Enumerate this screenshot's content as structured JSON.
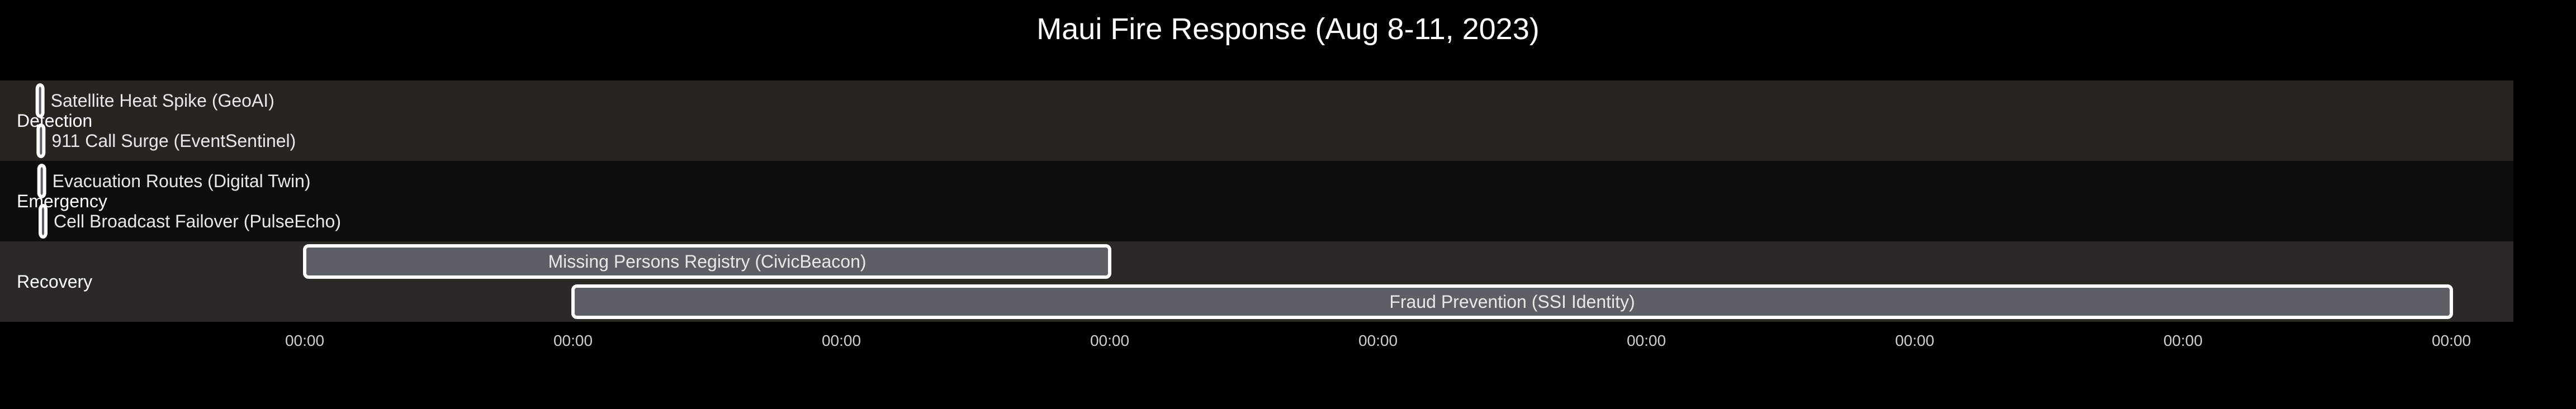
{
  "chart_data": {
    "type": "gantt",
    "title": "Maui Fire Response (Aug 8-11, 2023)",
    "sections": [
      {
        "name": "Detection",
        "tasks": [
          {
            "label": "Satellite Heat Spike (GeoAI)",
            "start": "2023-08-08 00:05",
            "end": "2023-08-08 00:06"
          },
          {
            "label": "911 Call Surge (EventSentinel)",
            "start": "2023-08-08 00:10",
            "end": "2023-08-08 00:11"
          }
        ]
      },
      {
        "name": "Emergency",
        "tasks": [
          {
            "label": "Evacuation Routes (Digital Twin)",
            "start": "2023-08-08 00:14",
            "end": "2023-08-08 00:18"
          },
          {
            "label": "Cell Broadcast Failover (PulseEcho)",
            "start": "2023-08-08 00:21",
            "end": "2023-08-08 00:22"
          }
        ]
      },
      {
        "name": "Recovery",
        "tasks": [
          {
            "label": "Missing Persons Registry (CivicBeacon)",
            "start": "2023-08-09 00:00",
            "end": "2023-08-12 00:00"
          },
          {
            "label": "Fraud Prevention (SSI Identity)",
            "start": "2023-08-10 00:00",
            "end": "2023-08-17 00:00"
          }
        ]
      }
    ],
    "x_ticks": [
      {
        "value": "2023-08-09",
        "label": "00:00"
      },
      {
        "value": "2023-08-10",
        "label": "00:00"
      },
      {
        "value": "2023-08-11",
        "label": "00:00"
      },
      {
        "value": "2023-08-12",
        "label": "00:00"
      },
      {
        "value": "2023-08-13",
        "label": "00:00"
      },
      {
        "value": "2023-08-14",
        "label": "00:00"
      },
      {
        "value": "2023-08-15",
        "label": "00:00"
      },
      {
        "value": "2023-08-16",
        "label": "00:00"
      },
      {
        "value": "2023-08-17",
        "label": "00:00"
      }
    ],
    "xlim": [
      "2023-08-08 00:00",
      "2023-08-17 00:15"
    ],
    "grid": false,
    "colors": {
      "background": "#000000",
      "section_bands": [
        "#282520",
        "#0e0e0e",
        "#2a2926"
      ],
      "bar_fill": "#5c6066",
      "bar_stroke": "#ffffff",
      "text": "#ffffff",
      "tick_text": "#cfcfcf"
    }
  }
}
